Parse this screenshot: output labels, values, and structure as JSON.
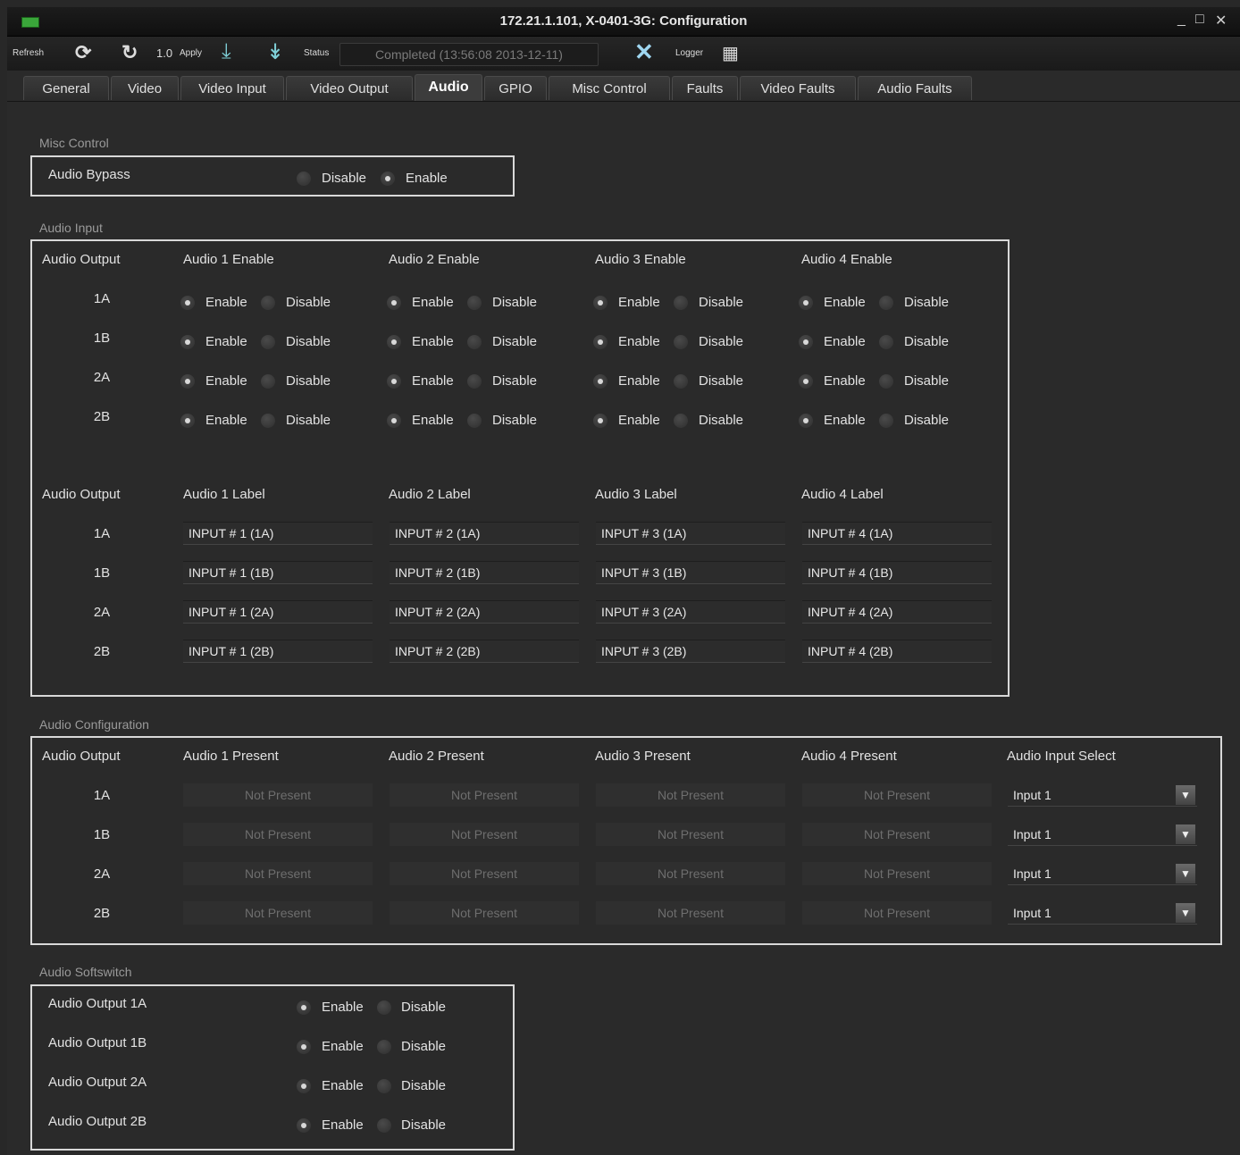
{
  "window": {
    "title": "172.21.1.101, X-0401-3G: Configuration",
    "controls": [
      "_",
      "□",
      "✕"
    ]
  },
  "toolbar": {
    "refresh_label": "Refresh",
    "version_label": "1.0",
    "apply_label": "Apply",
    "status_label": "Status",
    "status_value": "Completed  (13:56:08  2013-12-11)",
    "logger_label": "Logger"
  },
  "tabs": [
    "General",
    "Video",
    "Video Input",
    "Video Output",
    "Audio",
    "GPIO",
    "Misc Control",
    "Faults",
    "Video Faults",
    "Audio Faults"
  ],
  "active_tab": "Audio",
  "misc_control": {
    "title": "Misc Control",
    "audio_bypass_label": "Audio Bypass",
    "disable_label": "Disable",
    "enable_label": "Enable",
    "selected": "Enable"
  },
  "audio_input": {
    "title": "Audio Input",
    "output_header": "Audio Output",
    "enable_headers": [
      "Audio 1 Enable",
      "Audio 2 Enable",
      "Audio 3 Enable",
      "Audio 4 Enable"
    ],
    "label_headers": [
      "Audio 1 Label",
      "Audio 2 Label",
      "Audio 3 Label",
      "Audio 4 Label"
    ],
    "rows": [
      "1A",
      "1B",
      "2A",
      "2B"
    ],
    "enable_text": "Enable",
    "disable_text": "Disable",
    "labels": [
      [
        "INPUT # 1 (1A)",
        "INPUT # 2 (1A)",
        "INPUT # 3 (1A)",
        "INPUT # 4 (1A)"
      ],
      [
        "INPUT # 1 (1B)",
        "INPUT # 2 (1B)",
        "INPUT # 3 (1B)",
        "INPUT # 4 (1B)"
      ],
      [
        "INPUT # 1 (2A)",
        "INPUT # 2 (2A)",
        "INPUT # 3 (2A)",
        "INPUT # 4 (2A)"
      ],
      [
        "INPUT # 1 (2B)",
        "INPUT # 2 (2B)",
        "INPUT # 3 (2B)",
        "INPUT # 4 (2B)"
      ]
    ]
  },
  "audio_configuration": {
    "title": "Audio Configuration",
    "output_header": "Audio Output",
    "present_headers": [
      "Audio 1 Present",
      "Audio 2 Present",
      "Audio 3 Present",
      "Audio 4 Present"
    ],
    "select_header": "Audio Input Select",
    "rows": [
      "1A",
      "1B",
      "2A",
      "2B"
    ],
    "present_value": "Not Present",
    "select_values": [
      "Input 1",
      "Input 1",
      "Input 1",
      "Input 1"
    ]
  },
  "audio_softswitch": {
    "title": "Audio Softswitch",
    "rows": [
      "Audio Output 1A",
      "Audio Output 1B",
      "Audio Output 2A",
      "Audio Output 2B"
    ],
    "enable_text": "Enable",
    "disable_text": "Disable"
  },
  "colors": {
    "background": "#282828",
    "panel_border": "#d8d8d8",
    "section_title": "#9a9a9a",
    "app_icon": "#3aa63a"
  }
}
